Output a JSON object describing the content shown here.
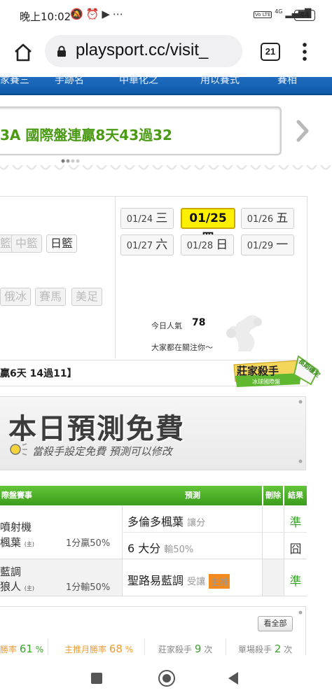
{
  "status_bar": {
    "time": "晚上10:02",
    "notification_icons": "🔕⏰▶⋯",
    "network": "4G",
    "battery": "44"
  },
  "browser": {
    "url": "playsport.cc/visit_",
    "tab_count": "21"
  },
  "site_nav": {
    "items": [
      "家賽三",
      "手跡名",
      "中華化之",
      "用以賽式",
      "賽相"
    ]
  },
  "banner": {
    "text": "3A 國際盤連贏8天43過32"
  },
  "sports": {
    "row1": [
      "籃",
      "中籃",
      "日籃"
    ],
    "row2": [
      "俄冰",
      "賽馬",
      "美足"
    ]
  },
  "dates": [
    {
      "date": "01/24",
      "day": "三"
    },
    {
      "date": "01/25",
      "day": "四"
    },
    {
      "date": "01/26",
      "day": "五"
    },
    {
      "date": "01/27",
      "day": "六"
    },
    {
      "date": "01/28",
      "day": "日"
    },
    {
      "date": "01/29",
      "day": "一"
    }
  ],
  "popularity": {
    "label": "今日人氣",
    "value": "78",
    "sub": "大家都在關注你～"
  },
  "record": {
    "text": "贏6天 14過11】"
  },
  "badge": {
    "title": "莊家殺手",
    "subtitle": "冰球國際盤",
    "ribbon": "長期穩定"
  },
  "promo": {
    "title": "本日預測免費",
    "subtitle": "當殺手設定免費  預測可以修改"
  },
  "table": {
    "headers": {
      "game": "際盤賽事",
      "prediction": "預測",
      "delete": "刪除",
      "result": "結果"
    },
    "rows": [
      {
        "team_a": "噴射機",
        "team_b": "楓葉",
        "home_mark": "(主)",
        "line": "1分贏50%",
        "picks": [
          {
            "text": "多倫多楓葉",
            "note": "讓分",
            "result": "準"
          },
          {
            "text": "6 大分",
            "note": "輸50%",
            "result": "囧"
          }
        ]
      },
      {
        "team_a": "藍調",
        "team_b": "狼人",
        "home_mark": "(主)",
        "line": "1分輸50%",
        "picks": [
          {
            "text": "聖路易藍調",
            "note": "受讓",
            "tag": "主推",
            "result": "準"
          }
        ]
      }
    ]
  },
  "stats": {
    "view_all": "看全部",
    "items": [
      {
        "label": "勝率",
        "value": "61",
        "unit": "%"
      },
      {
        "label": "主推月勝率",
        "value": "68",
        "unit": "%"
      },
      {
        "label": "莊家殺手",
        "value": "9",
        "unit": "次"
      },
      {
        "label": "單場殺手",
        "value": "2",
        "unit": "次"
      }
    ]
  },
  "colors": {
    "nav_blue": "#0e5aa8",
    "accent_green": "#4a9a14",
    "header_green": "#3b9c1b",
    "date_selected": "#fff000",
    "orange": "#f28a1e"
  }
}
